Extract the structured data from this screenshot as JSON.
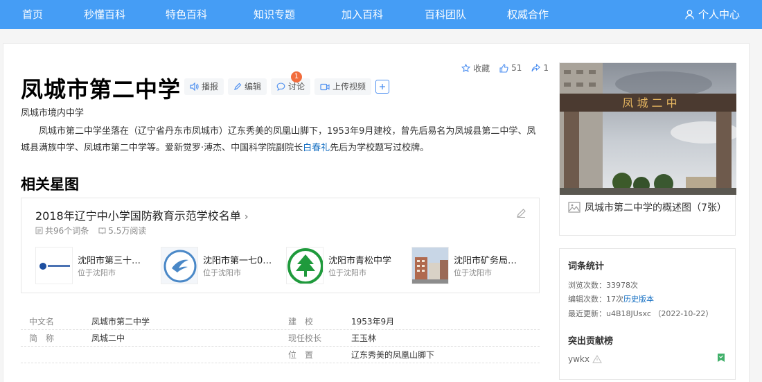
{
  "nav": {
    "items": [
      "首页",
      "秒懂百科",
      "特色百科",
      "知识专题",
      "加入百科",
      "百科团队",
      "权威合作"
    ],
    "user_label": "个人中心"
  },
  "entry": {
    "title": "凤城市第二中学",
    "tools": {
      "play": "播报",
      "edit": "编辑",
      "discuss": "讨论",
      "discuss_badge": "1",
      "upload": "上传视频"
    },
    "actions": {
      "collect": "收藏",
      "like_count": "51",
      "share_count": "1"
    },
    "subtitle": "凤城市境内中学",
    "summary_part1": "凤城市第二中学坐落在（辽宁省丹东市凤城市）辽东秀美的凤凰山脚下，1953年9月建校，曾先后易名为凤城县第二中学、凤城县满族中学、凤城市第二中学等。爱新觉罗·溥杰、中国科学院副院长",
    "summary_link": "白春礼",
    "summary_part2": "先后为学校题写过校牌。"
  },
  "star_graph": {
    "section_title": "相关星图",
    "title": "2018年辽宁中小学国防教育示范学校名单",
    "count": "共96个词条",
    "reads": "5.5万阅读",
    "items": [
      {
        "name": "沈阳市第三十…",
        "location": "位于沈阳市"
      },
      {
        "name": "沈阳市第一七0…",
        "location": "位于沈阳市"
      },
      {
        "name": "沈阳市青松中学",
        "location": "位于沈阳市"
      },
      {
        "name": "沈阳市矿务局…",
        "location": "位于沈阳市"
      }
    ]
  },
  "basic_info": [
    {
      "key": "中文名",
      "value": "凤城市第二中学",
      "key2": "建　校",
      "value2": "1953年9月"
    },
    {
      "key": "简　称",
      "value": "凤城二中",
      "key2": "现任校长",
      "value2": "王玉林"
    },
    {
      "key": "",
      "value": "",
      "key2": "位　置",
      "value2": "辽东秀美的凤凰山脚下"
    }
  ],
  "album": {
    "gate_text": "凤 城 二 中",
    "caption": "凤城市第二中学的概述图（7张）"
  },
  "stats": {
    "heading": "词条统计",
    "views_label": "浏览次数：",
    "views": "33978次",
    "edits_label": "编辑次数：",
    "edits": "17次",
    "history": "历史版本",
    "updated_label": "最近更新：",
    "updated": "u4B18JUsxc （2022-10-22）",
    "contrib_heading": "突出贡献榜",
    "contributor": "ywkx"
  },
  "colors": {
    "nav": "#459df5",
    "link": "#136ec2",
    "badge": "#f26d3d"
  }
}
